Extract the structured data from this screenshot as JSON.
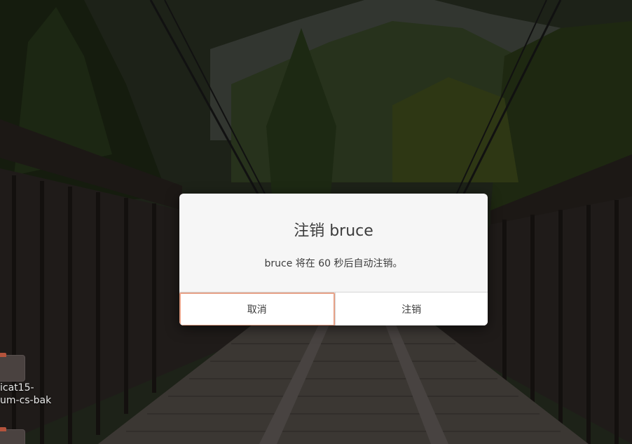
{
  "dialog": {
    "title": "注销 bruce",
    "message": "bruce 将在 60 秒后自动注销。",
    "cancel_label": "取消",
    "logout_label": "注销"
  },
  "desktop": {
    "icons": [
      {
        "name": "folder-icon",
        "label_line1": "icat15-",
        "label_line2": "um-cs-bak"
      },
      {
        "name": "folder-icon",
        "label_line1": "",
        "label_line2": ""
      }
    ]
  },
  "colors": {
    "dialog_bg": "#f6f6f6",
    "focus_ring": "#e7a288",
    "text": "#3c3c3c",
    "folder_tab": "#b4533c"
  }
}
